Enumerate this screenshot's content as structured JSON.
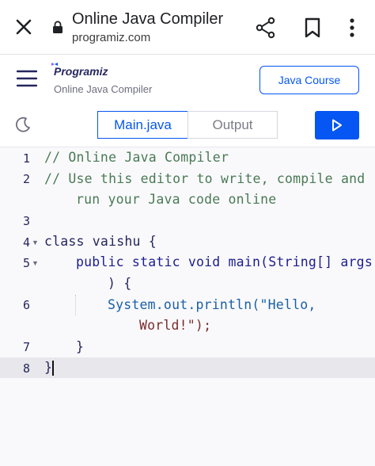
{
  "browser": {
    "title": "Online Java Compiler",
    "url": "programiz.com"
  },
  "header": {
    "logo": "Programiz",
    "subtitle": "Online Java Compiler",
    "course_button": "Java Course"
  },
  "toolbar": {
    "tabs": [
      {
        "label": "Main.java",
        "active": true
      },
      {
        "label": "Output",
        "active": false
      }
    ]
  },
  "editor": {
    "lines": [
      {
        "num": "1",
        "text": "// Online Java Compiler"
      },
      {
        "num": "2",
        "text": "// Use this editor to write, compile and"
      },
      {
        "num": "",
        "text": "run your Java code online"
      },
      {
        "num": "3",
        "text": ""
      },
      {
        "num": "4",
        "text": "class vaishu {"
      },
      {
        "num": "5",
        "text": "public static void main(String[] args"
      },
      {
        "num": "",
        "text": ") {"
      },
      {
        "num": "6",
        "text": "System.out.println(\"Hello,"
      },
      {
        "num": "",
        "text": "World!\");"
      },
      {
        "num": "7",
        "text": "}"
      },
      {
        "num": "8",
        "text": "}"
      }
    ]
  },
  "colors": {
    "accent": "#0556f3",
    "text": "#25265e",
    "comment": "#4a7a55"
  },
  "icons": [
    "close-icon",
    "lock-icon",
    "share-icon",
    "bookmark-icon",
    "more-vert-icon",
    "hamburger-menu-icon",
    "moon-icon",
    "play-icon"
  ]
}
